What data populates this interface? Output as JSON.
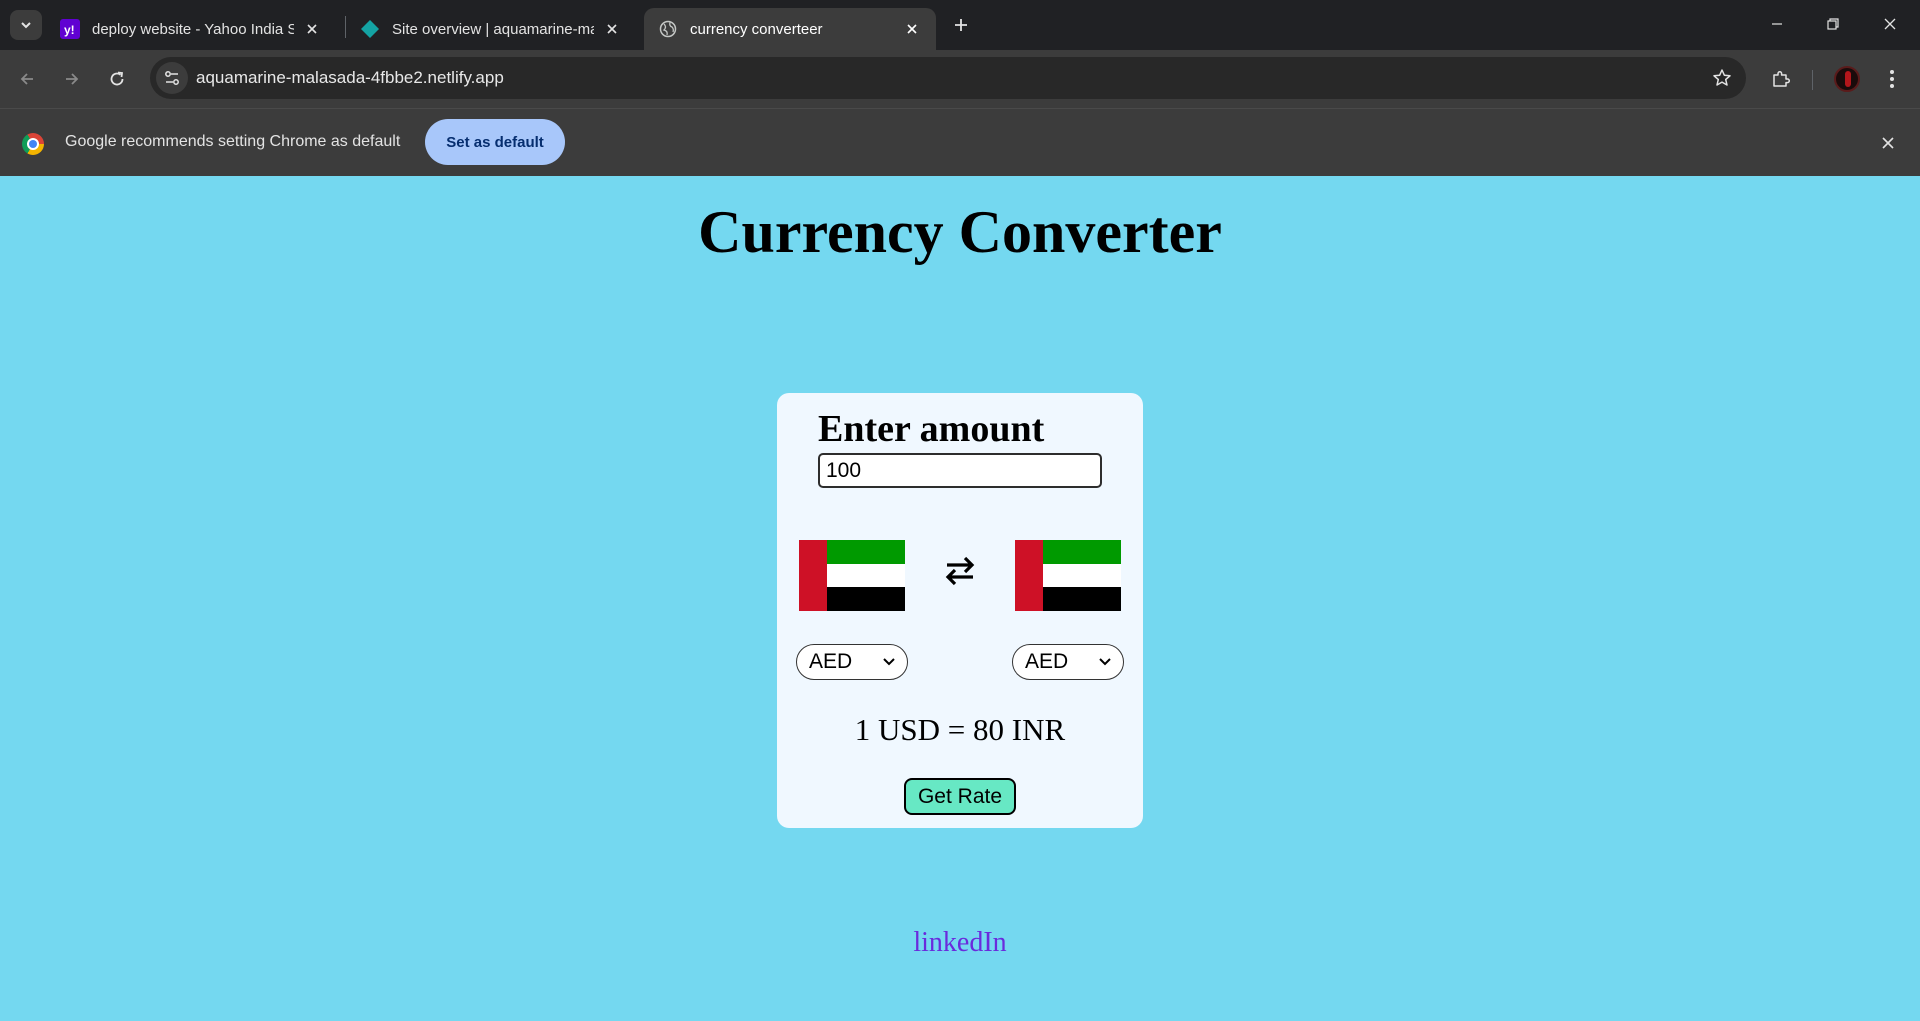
{
  "browser": {
    "tabs": [
      {
        "title": "deploy website - Yahoo India Search",
        "icon": "yahoo-icon",
        "active": false
      },
      {
        "title": "Site overview | aquamarine-malasada",
        "icon": "netlify-icon",
        "active": false
      },
      {
        "title": "currency converteer",
        "icon": "globe-icon",
        "active": true
      }
    ],
    "url": "aquamarine-malasada-4fbbe2.netlify.app"
  },
  "infobar": {
    "message": "Google recommends setting Chrome as default",
    "button_label": "Set as default"
  },
  "page": {
    "title": "Currency Converter",
    "amount_label": "Enter amount",
    "amount_value": "100",
    "from_currency": "AED",
    "to_currency": "AED",
    "rate_text": "1 USD = 80 INR",
    "get_rate_label": "Get Rate",
    "link_text": "linkedIn"
  },
  "colors": {
    "page_background": "#74d8f0",
    "card_background": "#f0f8ff",
    "button_background": "#67e8c4",
    "link": "#6a2bdc"
  }
}
